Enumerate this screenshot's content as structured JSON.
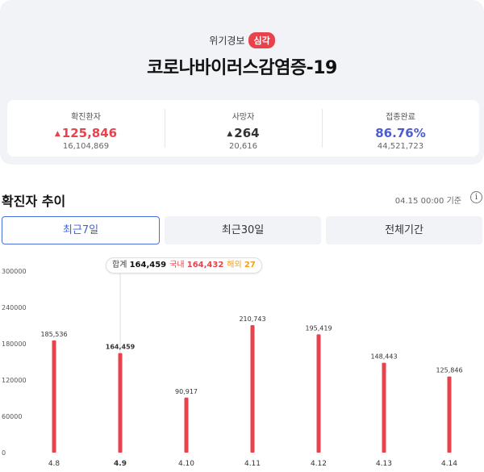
{
  "header": {
    "alert_label": "위기경보",
    "alert_level": "심각",
    "title": "코로나바이러스감염증-19"
  },
  "stats": [
    {
      "label": "확진환자",
      "arrow": "▲",
      "value": "125,846",
      "sub": "16,104,869",
      "color": "#e8434d"
    },
    {
      "label": "사망자",
      "arrow": "▲",
      "value": "264",
      "sub": "20,616",
      "color": "#333333"
    },
    {
      "label": "접종완료",
      "arrow": "",
      "value": "86.76%",
      "sub": "44,521,723",
      "color": "#4a5bd4"
    }
  ],
  "trend": {
    "title": "확진자 추이",
    "timestamp": "04.15 00:00 기준",
    "info_icon": "info-circle-icon",
    "tabs": [
      "최근7일",
      "최근30일",
      "전체기간"
    ],
    "active_tab": 0
  },
  "tooltip": {
    "total_label": "합계",
    "total_value": "164,459",
    "domestic_label": "국내",
    "domestic_value": "164,432",
    "overseas_label": "해외",
    "overseas_value": "27"
  },
  "chart_data": {
    "type": "bar",
    "categories": [
      "4.8",
      "4.9",
      "4.10",
      "4.11",
      "4.12",
      "4.13",
      "4.14"
    ],
    "values": [
      185536,
      164459,
      90917,
      210743,
      195419,
      148443,
      125846
    ],
    "value_labels": [
      "185,536",
      "164,459",
      "90,917",
      "210,743",
      "195,419",
      "148,443",
      "125,846"
    ],
    "yticks": [
      0,
      60000,
      120000,
      180000,
      240000,
      300000
    ],
    "ylim": [
      0,
      300000
    ],
    "selected_index": 1,
    "bar_color": "#e8434d",
    "title": "",
    "xlabel": "",
    "ylabel": ""
  }
}
